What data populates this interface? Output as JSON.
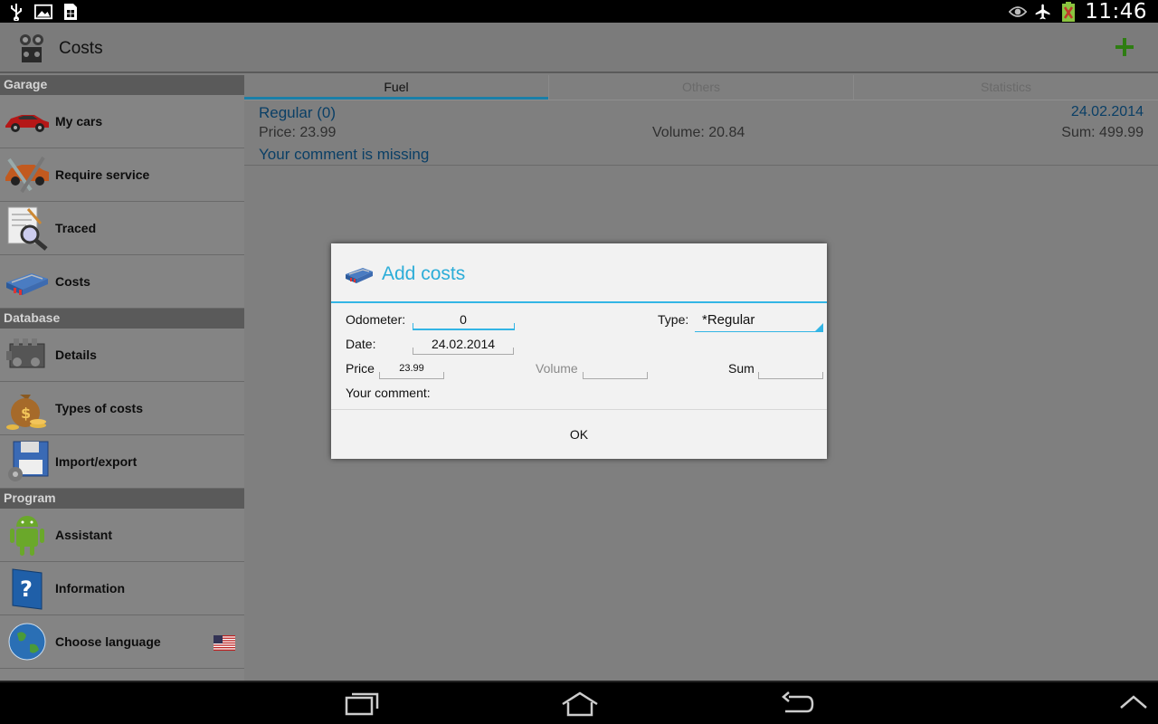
{
  "status_bar": {
    "time": "11:46",
    "left_icons": [
      "usb-icon",
      "image-icon",
      "sim-icon"
    ],
    "right_icons": [
      "eye-icon",
      "airplane-mode-icon",
      "battery-icon"
    ]
  },
  "action_bar": {
    "title": "Costs",
    "add_icon": "plus-icon",
    "accent_color": "#4caf1f"
  },
  "sidebar": {
    "sections": [
      {
        "header": "Garage"
      },
      {
        "header": "Database"
      },
      {
        "header": "Program"
      }
    ],
    "items": [
      {
        "label": "My cars",
        "icon": "car-icon"
      },
      {
        "label": "Require service",
        "icon": "repair-car-icon"
      },
      {
        "label": "Traced",
        "icon": "magnifier-icon"
      },
      {
        "label": "Costs",
        "icon": "fuel-card-icon"
      },
      {
        "label": "Details",
        "icon": "engine-icon"
      },
      {
        "label": "Types of costs",
        "icon": "money-bag-icon"
      },
      {
        "label": "Import/export",
        "icon": "floppy-disk-icon"
      },
      {
        "label": "Assistant",
        "icon": "android-icon"
      },
      {
        "label": "Information",
        "icon": "help-book-icon"
      },
      {
        "label": "Choose language",
        "icon": "globe-icon",
        "flag": "us-flag-icon"
      }
    ]
  },
  "tabs": [
    {
      "label": "Fuel",
      "active": true
    },
    {
      "label": "Others",
      "active": false
    },
    {
      "label": "Statistics",
      "active": false
    }
  ],
  "record": {
    "title": "Regular (0)",
    "date": "24.02.2014",
    "price": "Price: 23.99",
    "volume": "Volume: 20.84",
    "sum": "Sum: 499.99",
    "comment": "Your comment is missing"
  },
  "dialog": {
    "title": "Add costs",
    "icon": "fuel-card-icon",
    "odometer_label": "Odometer:",
    "odometer_value": "0",
    "type_label": "Type:",
    "type_value": "*Regular",
    "date_label": "Date:",
    "date_value": "24.02.2014",
    "price_label": "Price",
    "price_value": "23.99",
    "volume_label": "Volume",
    "volume_value": "",
    "sum_label": "Sum",
    "sum_value": "",
    "comment_label": "Your comment:",
    "ok_label": "OK",
    "accent_color": "#33b5e5"
  },
  "nav_bar": {
    "buttons": [
      "recent-apps-icon",
      "home-icon",
      "back-icon",
      "expand-up-icon"
    ]
  }
}
